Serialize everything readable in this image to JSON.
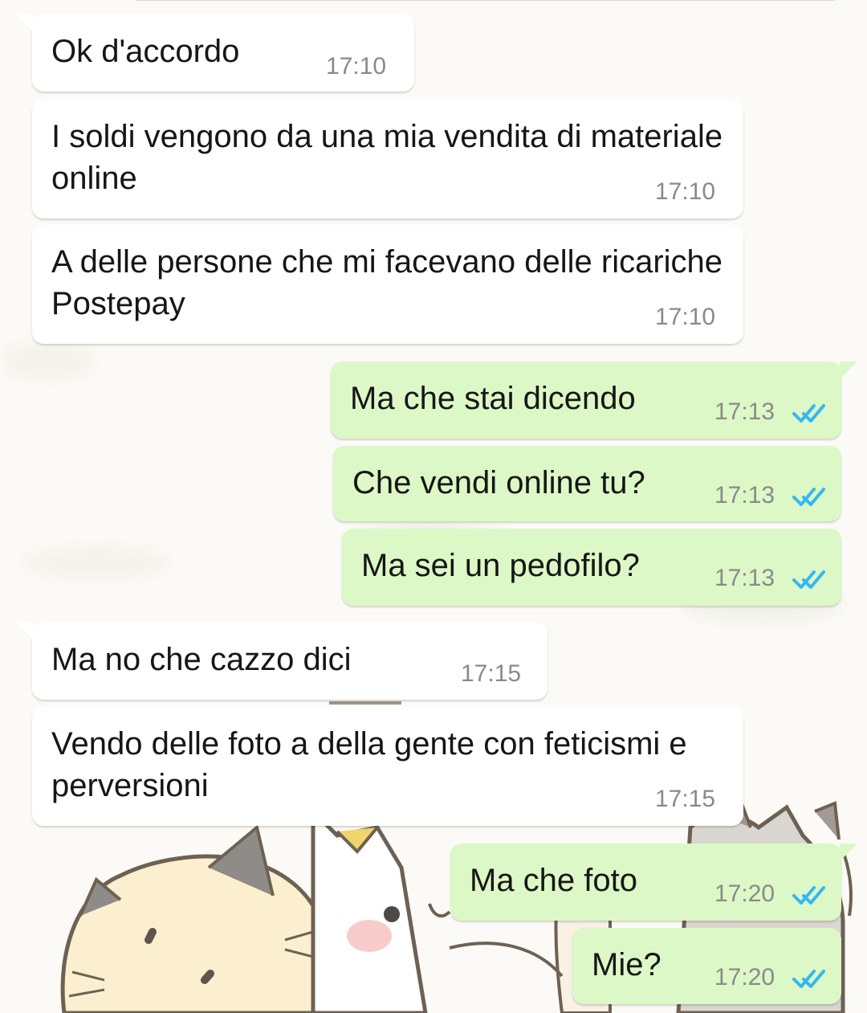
{
  "chat": {
    "messages": [
      {
        "direction": "in",
        "text": "Ok d'accordo",
        "time": "17:10"
      },
      {
        "direction": "in",
        "text": "I soldi vengono da una mia vendita di materiale online",
        "time": "17:10"
      },
      {
        "direction": "in",
        "text": "A delle persone che mi facevano delle ricariche Postepay",
        "time": "17:10"
      },
      {
        "direction": "out",
        "text": "Ma che stai dicendo",
        "time": "17:13",
        "status": "read"
      },
      {
        "direction": "out",
        "text": "Che vendi online tu?",
        "time": "17:13",
        "status": "read"
      },
      {
        "direction": "out",
        "text": "Ma sei un pedofilo?",
        "time": "17:13",
        "status": "read"
      },
      {
        "direction": "in",
        "text": "Ma no che cazzo dici",
        "time": "17:15"
      },
      {
        "direction": "in",
        "text": "Vendo delle foto a della gente con feticismi e perversioni",
        "time": "17:15"
      },
      {
        "direction": "out",
        "text": "Ma che foto",
        "time": "17:20",
        "status": "read"
      },
      {
        "direction": "out",
        "text": "Mie?",
        "time": "17:20",
        "status": "read"
      }
    ]
  },
  "icons": {
    "read_receipt": "double-check-icon",
    "wallpaper": "cat-doodle-wallpaper"
  },
  "colors": {
    "incoming_bubble": "#ffffff",
    "outgoing_bubble": "#dcf8c6",
    "read_tick": "#34b7f1",
    "timestamp": "#8a8a8a",
    "text": "#161616"
  }
}
